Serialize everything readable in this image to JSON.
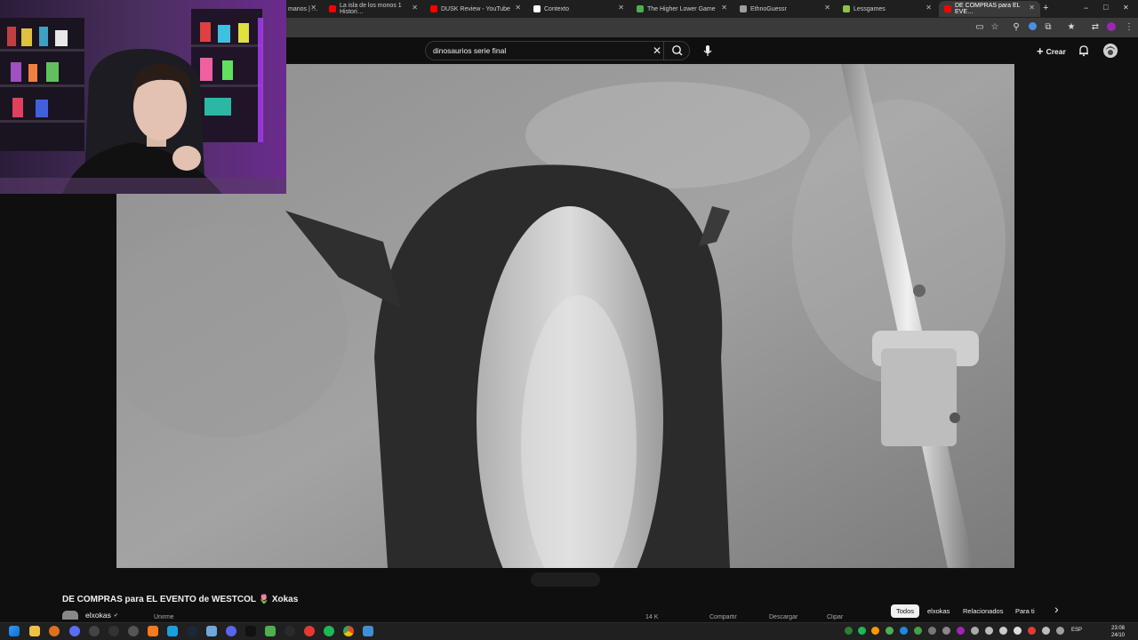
{
  "browser": {
    "tabs": [
      {
        "title": "manos | …",
        "favicon_color": "#e53935",
        "active": false
      },
      {
        "title": "La isla de los monos 1 Histori…",
        "favicon_color": "#ff0000",
        "active": false
      },
      {
        "title": "DUSK Review - YouTube",
        "favicon_color": "#ff0000",
        "active": false
      },
      {
        "title": "Contexto",
        "favicon_color": "#ffffff",
        "active": false
      },
      {
        "title": "The Higher Lower Game",
        "favicon_color": "#4caf50",
        "active": false
      },
      {
        "title": "EthnoGuessr",
        "favicon_color": "#9e9e9e",
        "active": false
      },
      {
        "title": "Lessgames",
        "favicon_color": "#8bc34a",
        "active": false
      },
      {
        "title": "DE COMPRAS para EL EVE…",
        "favicon_color": "#ff0000",
        "active": true
      }
    ],
    "new_tab": "+",
    "window_controls": [
      "−",
      "□",
      "✕"
    ]
  },
  "youtube": {
    "search": {
      "value": "dinosaurios serie final",
      "clear_icon": "✕"
    },
    "create_label": "Crear",
    "video": {
      "title": "DE COMPRAS para EL EVENTO de WESTCOL 🌷 Xokas",
      "channel": "elxokas",
      "verified_icon": "✔"
    },
    "chips": [
      {
        "label": "Todos",
        "selected": true
      },
      {
        "label": "elxokas",
        "selected": false
      },
      {
        "label": "Relacionados",
        "selected": false
      },
      {
        "label": "Para ti",
        "selected": false
      }
    ],
    "chips_next_icon": "›",
    "action_buttons": [
      "Unirme",
      "14 K",
      "Compartir",
      "Descargar",
      "Clipar"
    ]
  },
  "taskbar": {
    "language": "ESP",
    "time": "23:08",
    "date": "24/10"
  },
  "colors": {
    "yt_bg": "#0f0f0f",
    "accent_red": "#ff0000",
    "tabbar": "#1f1f1f",
    "toolbar": "#3a3a3a"
  }
}
